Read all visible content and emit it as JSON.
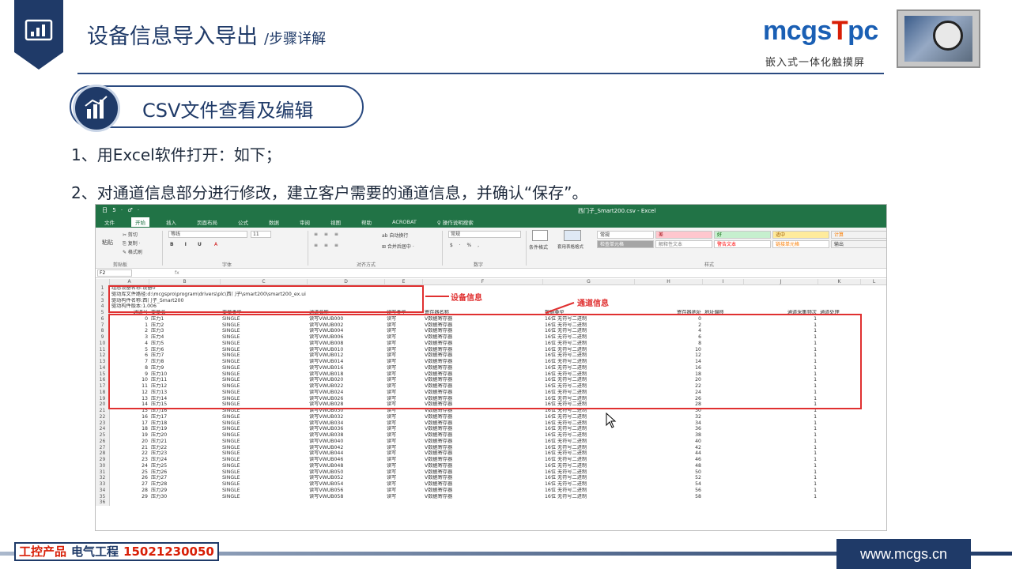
{
  "header": {
    "title": "设备信息导入导出",
    "subtitle": "/步骤详解",
    "brand_logo_part1": "mcgs",
    "brand_logo_part2": "T",
    "brand_logo_part3": "pc",
    "brand_tagline": "嵌入式一体化触摸屏"
  },
  "section": {
    "label": "CSV文件查看及编辑"
  },
  "steps": [
    "1、用Excel软件打开：如下；",
    "2、对通道信息部分进行修改，建立客户需要的通道信息，并确认“保存”。"
  ],
  "excel": {
    "quick_access": "日 5 · ♂ ·",
    "file_title": "西门子_Smart200.csv - Excel",
    "tabs": [
      "文件",
      "开始",
      "插入",
      "页面布局",
      "公式",
      "数据",
      "审阅",
      "视图",
      "帮助",
      "ACROBAT",
      "♀ 操作说明搜索"
    ],
    "ribbon": {
      "cut": "✂ 剪切",
      "copy": "⎘ 复制 ·",
      "format_painter": "✎ 格式刷",
      "paste": "粘贴",
      "clipboard": "剪贴板",
      "font_name": "等线",
      "font_size": "11",
      "font_group": "字体",
      "wrap_text": "ab 自动换行",
      "merge_center": "⊞ 合并后居中 ·",
      "alignment_group": "对齐方式",
      "number_format": "常规",
      "number_group": "数字",
      "conditional_format": "条件格式",
      "table_format": "套用表格格式",
      "styles_group": "样式",
      "styles": [
        {
          "label": "常规",
          "bg": "#ffffff",
          "color": "#333333"
        },
        {
          "label": "差",
          "bg": "#ffc7ce",
          "color": "#9c0006"
        },
        {
          "label": "好",
          "bg": "#c6efce",
          "color": "#006100"
        },
        {
          "label": "适中",
          "bg": "#ffeb9c",
          "color": "#9c5700"
        },
        {
          "label": "计算",
          "bg": "#f2f2f2",
          "color": "#fa7d00"
        },
        {
          "label": "检查单元格",
          "bg": "#a5a5a5",
          "color": "#ffffff"
        },
        {
          "label": "解释性文本",
          "bg": "#ffffff",
          "color": "#7f7f7f"
        },
        {
          "label": "警告文本",
          "bg": "#ffffff",
          "color": "#ff0000"
        },
        {
          "label": "链接单元格",
          "bg": "#ffffff",
          "color": "#fa7d00"
        },
        {
          "label": "输出",
          "bg": "#f2f2f2",
          "color": "#3f3f3f"
        }
      ]
    },
    "name_box": "F2",
    "fx": "fx",
    "column_headers": [
      "A",
      "B",
      "C",
      "D",
      "E",
      "F",
      "G",
      "H",
      "I",
      "J",
      "K",
      "L"
    ],
    "meta_rows": [
      "组态设备名称:设备0",
      "驱动库文件路径:d:\\mcgspro\\program\\drivers\\plc\\西门子\\smart200\\smart200_ex.ui",
      "驱动构件名称:西门子_Smart200",
      "驱动构件版本:1.006"
    ],
    "channel_header": [
      "通道号",
      "变量名",
      "变量类型",
      "通道名称",
      "读写类型",
      "寄存器名称",
      "数据类型",
      "寄存器地址",
      "地址偏移",
      "通道采集频次",
      "通道处理"
    ],
    "rows": [
      [
        "0",
        "压力1",
        "SINGLE",
        "读写VWUB000",
        "读写",
        "V数据寄存器",
        "16位 无符号二进制",
        "0",
        "",
        "1",
        ""
      ],
      [
        "1",
        "压力2",
        "SINGLE",
        "读写VWUB002",
        "读写",
        "V数据寄存器",
        "16位 无符号二进制",
        "2",
        "",
        "1",
        ""
      ],
      [
        "2",
        "压力3",
        "SINGLE",
        "读写VWUB004",
        "读写",
        "V数据寄存器",
        "16位 无符号二进制",
        "4",
        "",
        "1",
        ""
      ],
      [
        "3",
        "压力4",
        "SINGLE",
        "读写VWUB006",
        "读写",
        "V数据寄存器",
        "16位 无符号二进制",
        "6",
        "",
        "1",
        ""
      ],
      [
        "4",
        "压力5",
        "SINGLE",
        "读写VWUB008",
        "读写",
        "V数据寄存器",
        "16位 无符号二进制",
        "8",
        "",
        "1",
        ""
      ],
      [
        "5",
        "压力6",
        "SINGLE",
        "读写VWUB010",
        "读写",
        "V数据寄存器",
        "16位 无符号二进制",
        "10",
        "",
        "1",
        ""
      ],
      [
        "6",
        "压力7",
        "SINGLE",
        "读写VWUB012",
        "读写",
        "V数据寄存器",
        "16位 无符号二进制",
        "12",
        "",
        "1",
        ""
      ],
      [
        "7",
        "压力8",
        "SINGLE",
        "读写VWUB014",
        "读写",
        "V数据寄存器",
        "16位 无符号二进制",
        "14",
        "",
        "1",
        ""
      ],
      [
        "8",
        "压力9",
        "SINGLE",
        "读写VWUB016",
        "读写",
        "V数据寄存器",
        "16位 无符号二进制",
        "16",
        "",
        "1",
        ""
      ],
      [
        "9",
        "压力10",
        "SINGLE",
        "读写VWUB018",
        "读写",
        "V数据寄存器",
        "16位 无符号二进制",
        "18",
        "",
        "1",
        ""
      ],
      [
        "10",
        "压力11",
        "SINGLE",
        "读写VWUB020",
        "读写",
        "V数据寄存器",
        "16位 无符号二进制",
        "20",
        "",
        "1",
        ""
      ],
      [
        "11",
        "压力12",
        "SINGLE",
        "读写VWUB022",
        "读写",
        "V数据寄存器",
        "16位 无符号二进制",
        "22",
        "",
        "1",
        ""
      ],
      [
        "12",
        "压力13",
        "SINGLE",
        "读写VWUB024",
        "读写",
        "V数据寄存器",
        "16位 无符号二进制",
        "24",
        "",
        "1",
        ""
      ],
      [
        "13",
        "压力14",
        "SINGLE",
        "读写VWUB026",
        "读写",
        "V数据寄存器",
        "16位 无符号二进制",
        "26",
        "",
        "1",
        ""
      ],
      [
        "14",
        "压力15",
        "SINGLE",
        "读写VWUB028",
        "读写",
        "V数据寄存器",
        "16位 无符号二进制",
        "28",
        "",
        "1",
        ""
      ],
      [
        "15",
        "压力16",
        "SINGLE",
        "读写VWUB030",
        "读写",
        "V数据寄存器",
        "16位 无符号二进制",
        "30",
        "",
        "1",
        ""
      ],
      [
        "16",
        "压力17",
        "SINGLE",
        "读写VWUB032",
        "读写",
        "V数据寄存器",
        "16位 无符号二进制",
        "32",
        "",
        "1",
        ""
      ],
      [
        "17",
        "压力18",
        "SINGLE",
        "读写VWUB034",
        "读写",
        "V数据寄存器",
        "16位 无符号二进制",
        "34",
        "",
        "1",
        ""
      ],
      [
        "18",
        "压力19",
        "SINGLE",
        "读写VWUB036",
        "读写",
        "V数据寄存器",
        "16位 无符号二进制",
        "36",
        "",
        "1",
        ""
      ],
      [
        "19",
        "压力20",
        "SINGLE",
        "读写VWUB038",
        "读写",
        "V数据寄存器",
        "16位 无符号二进制",
        "38",
        "",
        "1",
        ""
      ],
      [
        "20",
        "压力21",
        "SINGLE",
        "读写VWUB040",
        "读写",
        "V数据寄存器",
        "16位 无符号二进制",
        "40",
        "",
        "1",
        ""
      ],
      [
        "21",
        "压力22",
        "SINGLE",
        "读写VWUB042",
        "读写",
        "V数据寄存器",
        "16位 无符号二进制",
        "42",
        "",
        "1",
        ""
      ],
      [
        "22",
        "压力23",
        "SINGLE",
        "读写VWUB044",
        "读写",
        "V数据寄存器",
        "16位 无符号二进制",
        "44",
        "",
        "1",
        ""
      ],
      [
        "23",
        "压力24",
        "SINGLE",
        "读写VWUB046",
        "读写",
        "V数据寄存器",
        "16位 无符号二进制",
        "46",
        "",
        "1",
        ""
      ],
      [
        "24",
        "压力25",
        "SINGLE",
        "读写VWUB048",
        "读写",
        "V数据寄存器",
        "16位 无符号二进制",
        "48",
        "",
        "1",
        ""
      ],
      [
        "25",
        "压力26",
        "SINGLE",
        "读写VWUB050",
        "读写",
        "V数据寄存器",
        "16位 无符号二进制",
        "50",
        "",
        "1",
        ""
      ],
      [
        "26",
        "压力27",
        "SINGLE",
        "读写VWUB052",
        "读写",
        "V数据寄存器",
        "16位 无符号二进制",
        "52",
        "",
        "1",
        ""
      ],
      [
        "27",
        "压力28",
        "SINGLE",
        "读写VWUB054",
        "读写",
        "V数据寄存器",
        "16位 无符号二进制",
        "54",
        "",
        "1",
        ""
      ],
      [
        "28",
        "压力29",
        "SINGLE",
        "读写VWUB056",
        "读写",
        "V数据寄存器",
        "16位 无符号二进制",
        "56",
        "",
        "1",
        ""
      ],
      [
        "29",
        "压力30",
        "SINGLE",
        "读写VWUB058",
        "读写",
        "V数据寄存器",
        "16位 无符号二进制",
        "58",
        "",
        "1",
        ""
      ]
    ],
    "last_row_number": "36",
    "annotation_device": "设备信息",
    "annotation_channel": "通道信息"
  },
  "footer": {
    "contact_part1": "工控产品",
    "contact_part2": "电气工程",
    "contact_phone": "15021230050",
    "url": "www.mcgs.cn"
  },
  "colors": {
    "brand_navy": "#1f3a68",
    "excel_green": "#217346",
    "annotation_red": "#e03030",
    "logo_blue": "#1a5fb4",
    "logo_red": "#d81e06"
  },
  "icons": [
    "chart-badge-icon",
    "bar-chart-icon",
    "mouse-cursor-icon",
    "arrow-icon"
  ]
}
